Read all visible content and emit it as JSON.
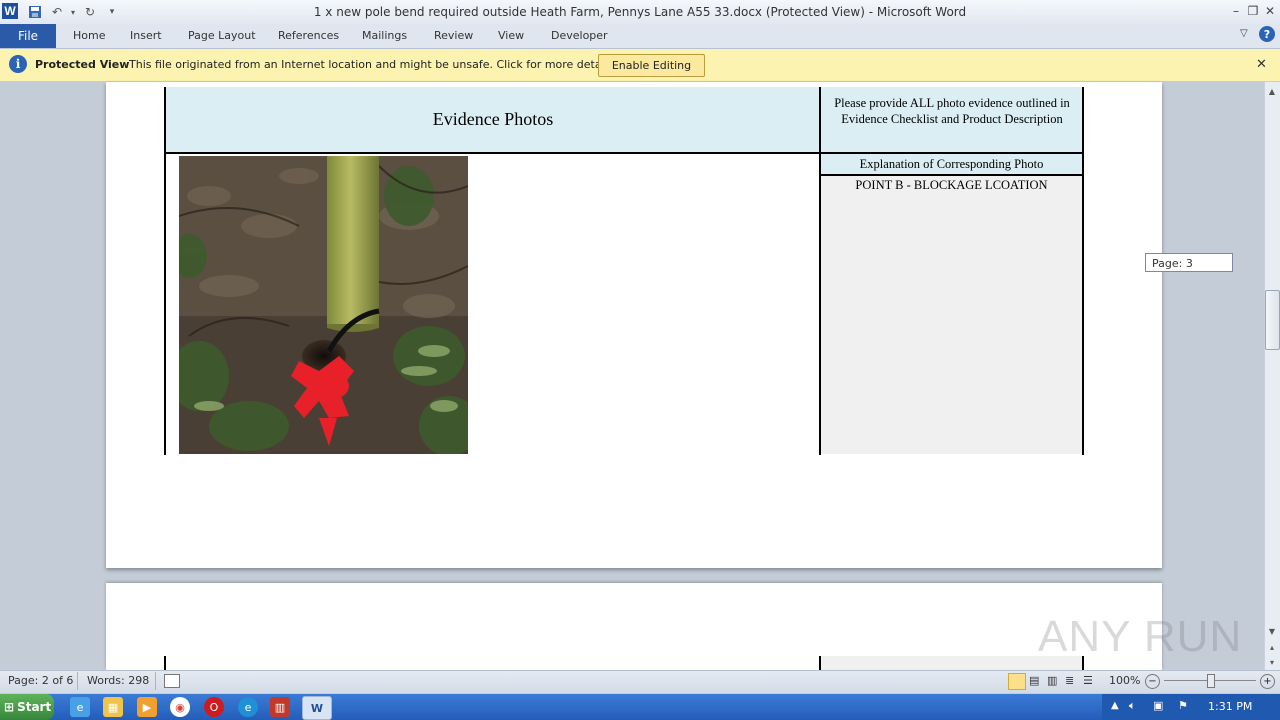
{
  "window": {
    "title": "1 x new pole bend required outside Heath Farm, Pennys Lane A55 33.docx (Protected View)  -  Microsoft Word",
    "logo_letter": "W"
  },
  "ribbon": {
    "file_label": "File",
    "tabs": [
      "Home",
      "Insert",
      "Page Layout",
      "References",
      "Mailings",
      "Review",
      "View",
      "Developer"
    ]
  },
  "protected_view": {
    "title": "Protected View",
    "message": "This file originated from an Internet location and might be unsafe. Click for more details.",
    "button_label": "Enable Editing",
    "icon": "info-icon"
  },
  "document": {
    "header_title": "Evidence  Photos",
    "header_note": "Please provide ALL  photo evidence outlined in Evidence Checklist and Product Description",
    "explanation_header": "Explanation  of Corresponding Photo",
    "explanation_text": "POINT  B - BLOCKAGE  LCOATION",
    "photo_icon": "photo-of-pole-with-red-paint-marking"
  },
  "page_tooltip": "Page: 3",
  "status_bar": {
    "page": "Page: 2 of 6",
    "words": "Words: 298",
    "zoom": "100%"
  },
  "taskbar": {
    "start_label": "Start",
    "clock": "1:31 PM"
  },
  "watermark": "ANY RUN",
  "colors": {
    "table_header_bg": "#dbeef4",
    "protected_bar_bg": "#fdf3b0",
    "file_tab_bg": "#2a5aa8",
    "taskbar_bg": "#245dba",
    "paint_red": "#e8202a"
  }
}
